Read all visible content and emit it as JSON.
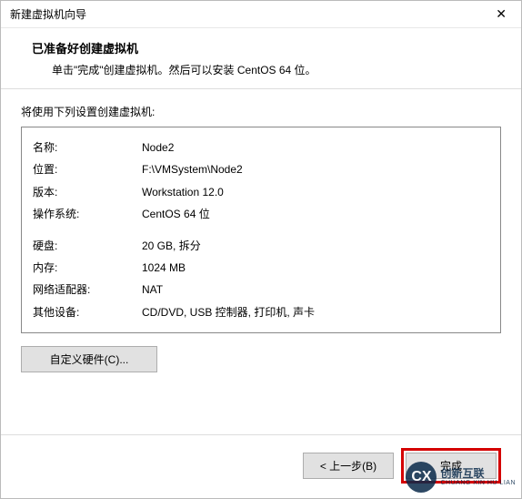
{
  "window": {
    "title": "新建虚拟机向导",
    "close_glyph": "✕"
  },
  "header": {
    "title": "已准备好创建虚拟机",
    "subtitle": "单击\"完成\"创建虚拟机。然后可以安装 CentOS 64 位。"
  },
  "body": {
    "section_label": "将使用下列设置创建虚拟机:",
    "rows1": [
      {
        "label": "名称:",
        "value": "Node2"
      },
      {
        "label": "位置:",
        "value": "F:\\VMSystem\\Node2"
      },
      {
        "label": "版本:",
        "value": "Workstation 12.0"
      },
      {
        "label": "操作系统:",
        "value": "CentOS 64 位"
      }
    ],
    "rows2": [
      {
        "label": "硬盘:",
        "value": "20 GB, 拆分"
      },
      {
        "label": "内存:",
        "value": "1024 MB"
      },
      {
        "label": "网络适配器:",
        "value": "NAT"
      },
      {
        "label": "其他设备:",
        "value": "CD/DVD, USB 控制器, 打印机, 声卡"
      }
    ],
    "customize_label": "自定义硬件(C)..."
  },
  "footer": {
    "back_label": "< 上一步(B)",
    "finish_label": "完成"
  },
  "watermark": {
    "logo": "CX",
    "cn": "创新互联",
    "en": "CHUANG XIN HU LIAN"
  }
}
